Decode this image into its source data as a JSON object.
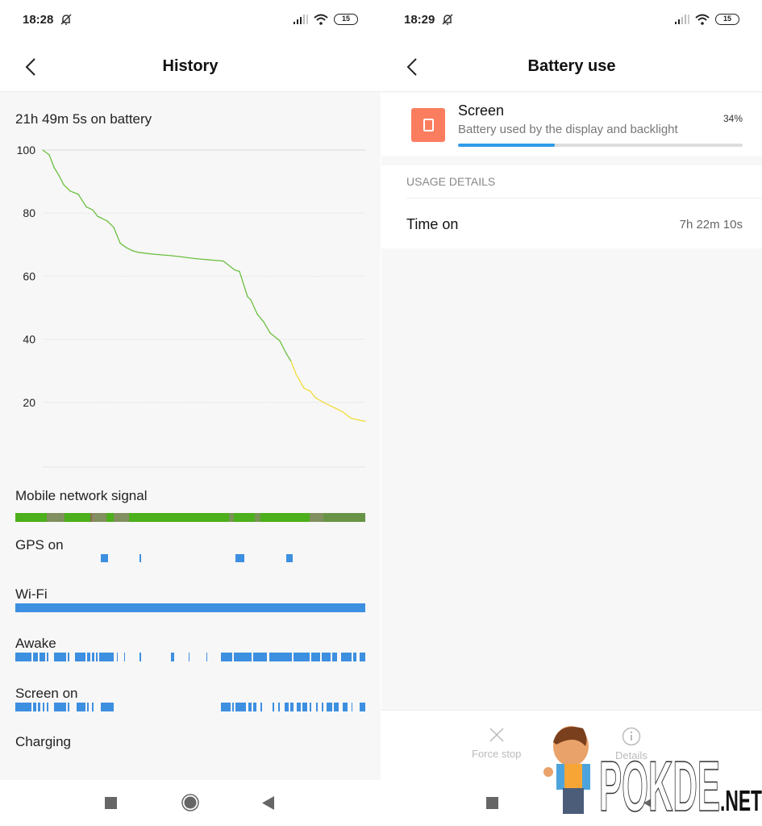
{
  "left": {
    "status": {
      "time": "18:28",
      "battery_level": "15"
    },
    "title": "History",
    "summary": "21h 49m 5s on battery",
    "chart_data": {
      "type": "line",
      "title": "",
      "xlabel": "",
      "ylabel": "",
      "ylim": [
        0,
        100
      ],
      "yticks": [
        "100",
        "80",
        "60",
        "40",
        "20"
      ],
      "ytick_values": [
        100,
        80,
        60,
        40,
        20
      ],
      "grid": true,
      "x_unit": "fraction of 21h 49m 5s",
      "series": [
        {
          "name": "battery-level",
          "color": "#6cbf3f",
          "low_color": "#f2dc3a",
          "low_threshold": 30,
          "x": [
            0,
            0.02,
            0.035,
            0.05,
            0.065,
            0.085,
            0.11,
            0.135,
            0.155,
            0.17,
            0.2,
            0.22,
            0.24,
            0.26,
            0.28,
            0.3,
            0.34,
            0.4,
            0.48,
            0.56,
            0.595,
            0.61,
            0.635,
            0.645,
            0.665,
            0.685,
            0.705,
            0.735,
            0.755,
            0.77,
            0.785,
            0.81,
            0.83,
            0.845,
            0.87,
            0.89,
            0.91,
            0.93,
            0.955,
            0.975,
            1.0
          ],
          "y": [
            100,
            98.5,
            94.5,
            92,
            89,
            87,
            86,
            82,
            81,
            79,
            77.5,
            75.5,
            70.5,
            69,
            68,
            67.5,
            67,
            66.5,
            65.5,
            64.8,
            62,
            61.5,
            53.5,
            52.5,
            48,
            45.5,
            42,
            39.5,
            35.5,
            33,
            29,
            24.5,
            23.5,
            21.5,
            20,
            19,
            18,
            17,
            15,
            14.5,
            14
          ]
        }
      ]
    },
    "tracks": [
      {
        "label": "Mobile network signal",
        "type": "signal",
        "base_color": "#4caf1b",
        "segments": [
          [
            0.09,
            0.14,
            "#8c8a6a"
          ],
          [
            0.125,
            0.13,
            "#7a8f5a"
          ],
          [
            0.215,
            0.225,
            "#8a6a4a"
          ],
          [
            0.22,
            0.26,
            "#8c8a6a"
          ],
          [
            0.28,
            0.325,
            "#8c8a6a"
          ],
          [
            0.61,
            0.625,
            "#7f8f5f"
          ],
          [
            0.685,
            0.7,
            "#7f8f5f"
          ],
          [
            0.84,
            0.88,
            "#8c8a6a"
          ],
          [
            0.88,
            1.0,
            "#6f8f4f"
          ]
        ]
      },
      {
        "label": "GPS on",
        "type": "bars",
        "color": "#3d8fe0",
        "segments": [
          [
            0.245,
            0.265
          ],
          [
            0.355,
            0.358
          ],
          [
            0.63,
            0.655
          ],
          [
            0.775,
            0.792
          ]
        ]
      },
      {
        "label": "Wi-Fi",
        "type": "bars",
        "color": "#3d8fe0",
        "segments": [
          [
            0,
            1
          ]
        ]
      },
      {
        "label": "Awake",
        "type": "bars",
        "color": "#3d8fe0",
        "segments": [
          [
            0,
            0.045
          ],
          [
            0.05,
            0.065
          ],
          [
            0.07,
            0.085
          ],
          [
            0.09,
            0.093
          ],
          [
            0.11,
            0.145
          ],
          [
            0.15,
            0.155
          ],
          [
            0.17,
            0.2
          ],
          [
            0.205,
            0.215
          ],
          [
            0.22,
            0.225
          ],
          [
            0.23,
            0.235
          ],
          [
            0.24,
            0.28
          ],
          [
            0.29,
            0.292
          ],
          [
            0.31,
            0.312
          ],
          [
            0.355,
            0.357
          ],
          [
            0.445,
            0.447
          ],
          [
            0.45,
            0.452
          ],
          [
            0.495,
            0.497
          ],
          [
            0.545,
            0.547
          ],
          [
            0.588,
            0.62
          ],
          [
            0.625,
            0.675
          ],
          [
            0.68,
            0.72
          ],
          [
            0.725,
            0.79
          ],
          [
            0.795,
            0.84
          ],
          [
            0.845,
            0.87
          ],
          [
            0.875,
            0.9
          ],
          [
            0.905,
            0.92
          ],
          [
            0.93,
            0.96
          ],
          [
            0.965,
            0.975
          ],
          [
            0.985,
            1.0
          ]
        ]
      },
      {
        "label": "Screen on",
        "type": "bars",
        "color": "#3d8fe0",
        "segments": [
          [
            0,
            0.045
          ],
          [
            0.05,
            0.06
          ],
          [
            0.065,
            0.072
          ],
          [
            0.078,
            0.082
          ],
          [
            0.09,
            0.093
          ],
          [
            0.11,
            0.145
          ],
          [
            0.15,
            0.155
          ],
          [
            0.175,
            0.2
          ],
          [
            0.205,
            0.21
          ],
          [
            0.22,
            0.222
          ],
          [
            0.245,
            0.28
          ],
          [
            0.588,
            0.615
          ],
          [
            0.62,
            0.625
          ],
          [
            0.63,
            0.66
          ],
          [
            0.665,
            0.675
          ],
          [
            0.68,
            0.69
          ],
          [
            0.7,
            0.705
          ],
          [
            0.735,
            0.74
          ],
          [
            0.75,
            0.755
          ],
          [
            0.77,
            0.78
          ],
          [
            0.785,
            0.795
          ],
          [
            0.805,
            0.815
          ],
          [
            0.82,
            0.835
          ],
          [
            0.84,
            0.845
          ],
          [
            0.86,
            0.865
          ],
          [
            0.875,
            0.88
          ],
          [
            0.89,
            0.905
          ],
          [
            0.91,
            0.925
          ],
          [
            0.935,
            0.95
          ],
          [
            0.96,
            0.963
          ],
          [
            0.985,
            1.0
          ]
        ]
      },
      {
        "label": "Charging",
        "type": "bars",
        "color": "#3d8fe0",
        "segments": []
      }
    ]
  },
  "right": {
    "status": {
      "time": "18:29",
      "battery_level": "15"
    },
    "title": "Battery use",
    "item": {
      "name": "Screen",
      "description": "Battery used by the display and backlight",
      "percent_label": "34%",
      "percent_value": 34,
      "icon": "screen-icon",
      "icon_color": "#fb7d5f",
      "bar_color": "#2f9be8"
    },
    "section_header": "USAGE DETAILS",
    "details": [
      {
        "label": "Time on",
        "value": "7h 22m 10s"
      }
    ],
    "actions": [
      {
        "label": "Force stop",
        "icon": "close-icon"
      },
      {
        "label": "Details",
        "icon": "info-icon"
      }
    ]
  },
  "watermark": {
    "text": "POKDE",
    "suffix": ".NET"
  }
}
